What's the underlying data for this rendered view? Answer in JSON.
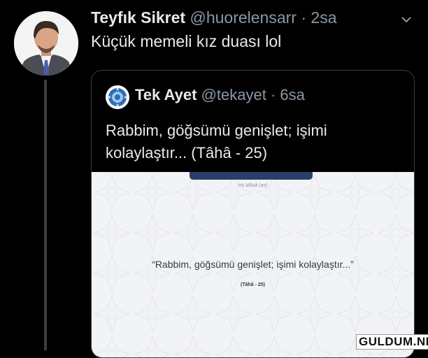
{
  "tweet": {
    "display_name": "Teyfık Sikret",
    "handle": "@huorelensarr",
    "separator": "·",
    "time": "2sa",
    "text": "Küçük memeli kız duası lol",
    "avatar_icon": "profile-photo-man-in-suit"
  },
  "quote": {
    "display_name": "Tek Ayet",
    "handle": "@tekayet",
    "separator": "·",
    "time": "6sa",
    "text": "Rabbim, göğsümü genişlet; işimi kolaylaştır... (Tâhâ - 25)",
    "avatar_icon": "blue-ornament-emblem"
  },
  "media": {
    "source": "Hz.Mûsâ (as)",
    "quote": "“Rabbim, göğsümü genişlet; işimi kolaylaştır...”",
    "reference": "(Tâhâ - 25)"
  },
  "watermark": "GULDUM.NET",
  "colors": {
    "background": "#000000",
    "text_primary": "#e7e9ea",
    "text_secondary": "#8b98a5",
    "border": "#3a3f44",
    "media_bg": "#f2f3f6",
    "media_bar": "#2b3e6a"
  }
}
